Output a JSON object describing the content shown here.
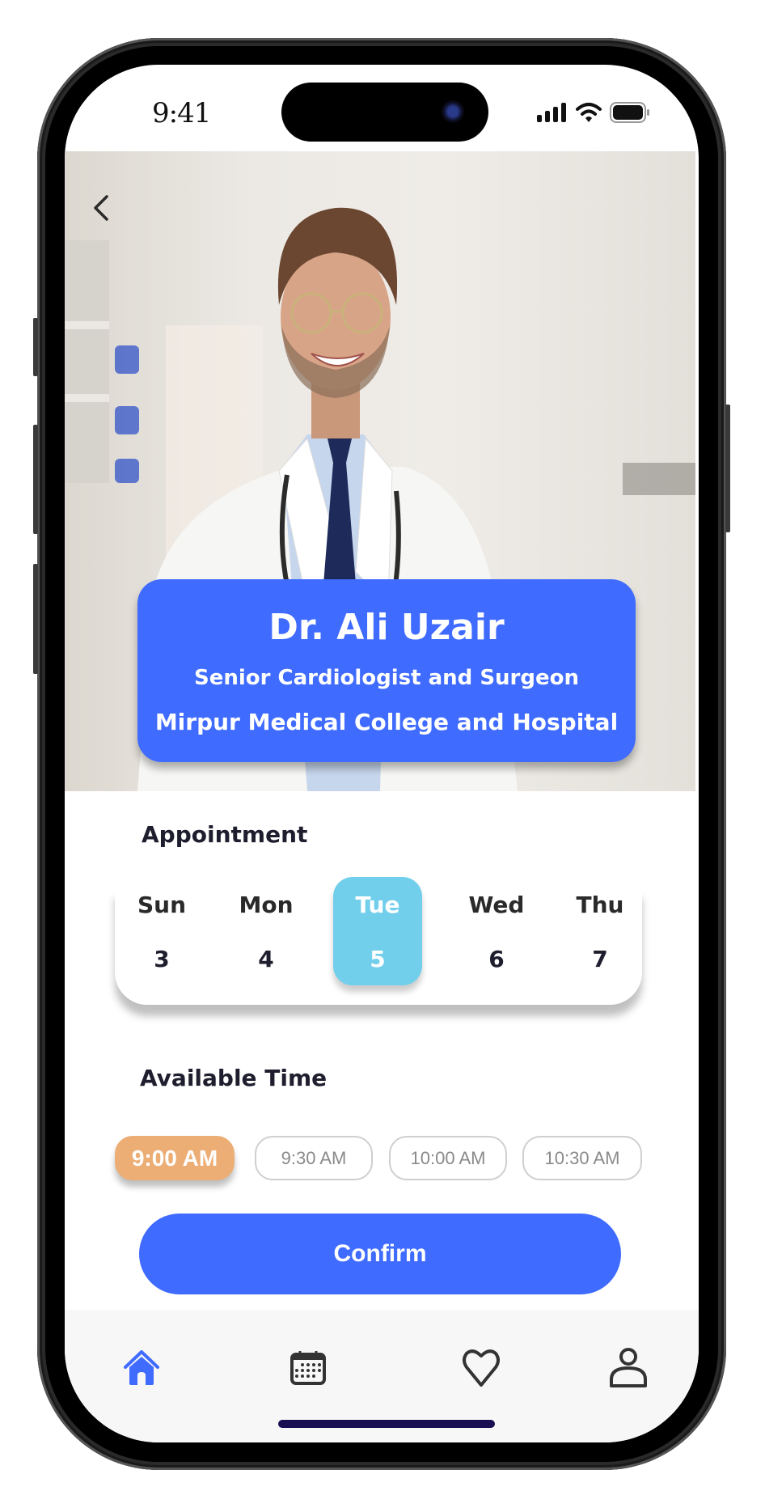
{
  "status_bar": {
    "time": "9:41",
    "icons": [
      "cellular-signal-icon",
      "wifi-icon",
      "battery-icon"
    ]
  },
  "header": {
    "back_icon": "chevron-left-icon"
  },
  "doctor": {
    "name": "Dr. Ali Uzair",
    "specialty": "Senior Cardiologist and Surgeon",
    "hospital": "Mirpur Medical College and Hospital"
  },
  "appointment": {
    "title": "Appointment",
    "days": [
      {
        "name": "Sun",
        "date": "3",
        "selected": false
      },
      {
        "name": "Mon",
        "date": "4",
        "selected": false
      },
      {
        "name": "Tue",
        "date": "5",
        "selected": true
      },
      {
        "name": "Wed",
        "date": "6",
        "selected": false
      },
      {
        "name": "Thu",
        "date": "7",
        "selected": false
      }
    ]
  },
  "available_time": {
    "title": "Available Time",
    "slots": [
      {
        "label": "9:00 AM",
        "selected": true
      },
      {
        "label": "9:30 AM",
        "selected": false
      },
      {
        "label": "10:00 AM",
        "selected": false
      },
      {
        "label": "10:30 AM",
        "selected": false
      }
    ]
  },
  "actions": {
    "confirm_label": "Confirm"
  },
  "bottom_nav": {
    "items": [
      {
        "icon": "home-icon",
        "active": true
      },
      {
        "icon": "calendar-icon",
        "active": false
      },
      {
        "icon": "heart-icon",
        "active": false
      },
      {
        "icon": "profile-icon",
        "active": false
      }
    ]
  },
  "colors": {
    "primary": "#3f6bff",
    "selected_day": "#72cfec",
    "selected_time": "#ecae75",
    "text_dark": "#1e1e2e",
    "nav_background": "#f7f7f7",
    "home_indicator": "#1a0f52"
  }
}
